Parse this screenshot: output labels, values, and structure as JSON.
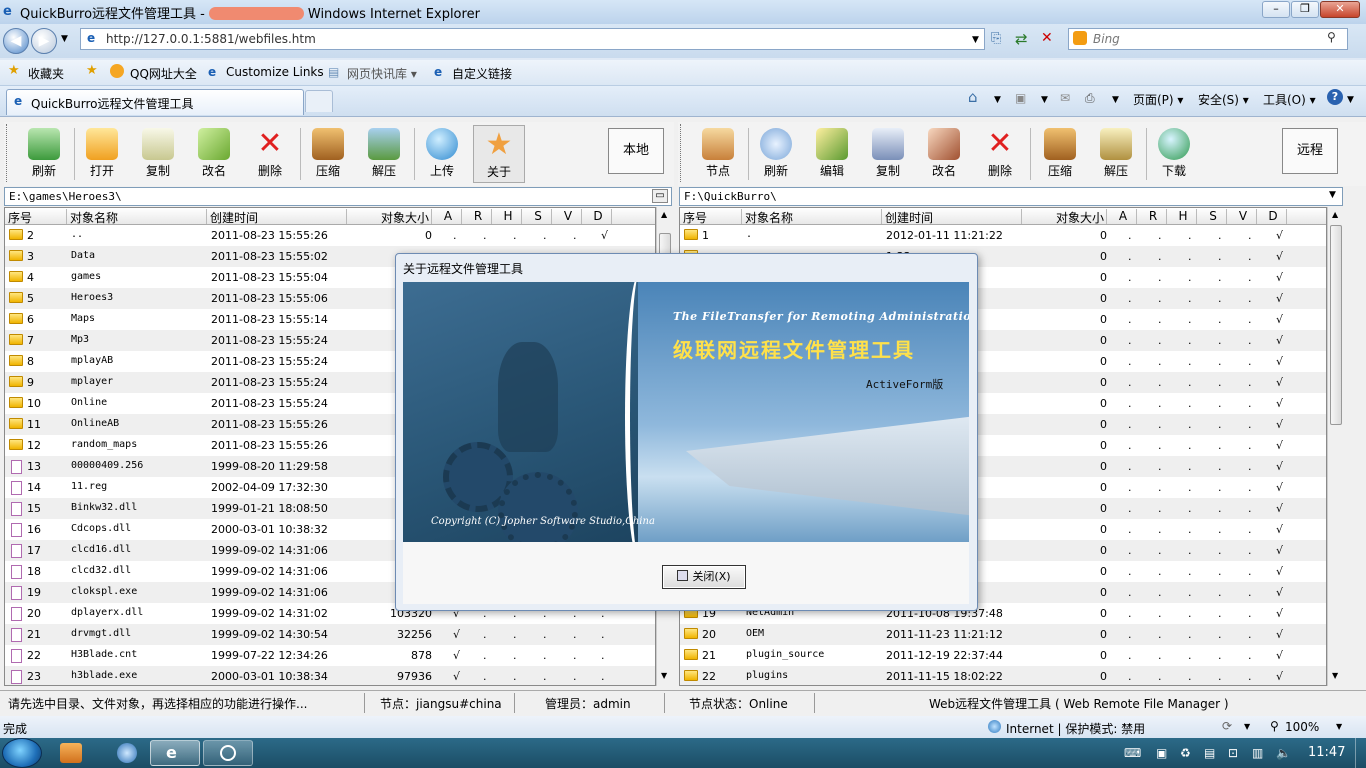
{
  "window": {
    "title_prefix": "QuickBurro远程文件管理工具 -",
    "title_suffix": "Windows Internet Explorer"
  },
  "address": {
    "url": "http://127.0.0.1:5881/webfiles.htm",
    "search_placeholder": "Bing"
  },
  "favorites": {
    "items": [
      "收藏夹",
      "QQ网址大全",
      "Customize Links",
      "网页快讯库 ▾",
      "自定义链接"
    ]
  },
  "tab": {
    "label": "QuickBurro远程文件管理工具"
  },
  "commands": {
    "page": "页面(P) ▾",
    "safety": "安全(S) ▾",
    "tools": "工具(O) ▾"
  },
  "left_toolbar": {
    "buttons": [
      "刷新",
      "打开",
      "复制",
      "改名",
      "删除",
      "压缩",
      "解压",
      "上传",
      "关于"
    ],
    "mode": "本地"
  },
  "right_toolbar": {
    "buttons": [
      "节点",
      "刷新",
      "编辑",
      "复制",
      "改名",
      "删除",
      "压缩",
      "解压",
      "下载"
    ],
    "mode": "远程"
  },
  "left_path": "E:\\games\\Heroes3\\",
  "right_path": "F:\\QuickBurro\\",
  "columns": {
    "seq": "序号",
    "name": "对象名称",
    "created": "创建时间",
    "size": "对象大小",
    "a": "A",
    "r": "R",
    "h": "H",
    "s": "S",
    "v": "V",
    "d": "D"
  },
  "left_rows": [
    {
      "n": "2",
      "name": "..",
      "t": "2011-08-23 15:55:26",
      "sz": "0",
      "a": ".",
      "r": ".",
      "h": ".",
      "s": ".",
      "v": ".",
      "d": "√",
      "dir": true
    },
    {
      "n": "3",
      "name": "Data",
      "t": "2011-08-23 15:55:02",
      "sz": "",
      "a": "",
      "r": "",
      "h": "",
      "s": "",
      "v": "",
      "d": "",
      "dir": true
    },
    {
      "n": "4",
      "name": "games",
      "t": "2011-08-23 15:55:04",
      "sz": "",
      "a": "",
      "r": "",
      "h": "",
      "s": "",
      "v": "",
      "d": "",
      "dir": true
    },
    {
      "n": "5",
      "name": "Heroes3",
      "t": "2011-08-23 15:55:06",
      "sz": "",
      "a": "",
      "r": "",
      "h": "",
      "s": "",
      "v": "",
      "d": "",
      "dir": true
    },
    {
      "n": "6",
      "name": "Maps",
      "t": "2011-08-23 15:55:14",
      "sz": "",
      "a": "",
      "r": "",
      "h": "",
      "s": "",
      "v": "",
      "d": "",
      "dir": true
    },
    {
      "n": "7",
      "name": "Mp3",
      "t": "2011-08-23 15:55:24",
      "sz": "",
      "a": "",
      "r": "",
      "h": "",
      "s": "",
      "v": "",
      "d": "",
      "dir": true
    },
    {
      "n": "8",
      "name": "mplayAB",
      "t": "2011-08-23 15:55:24",
      "sz": "",
      "a": "",
      "r": "",
      "h": "",
      "s": "",
      "v": "",
      "d": "",
      "dir": true
    },
    {
      "n": "9",
      "name": "mplayer",
      "t": "2011-08-23 15:55:24",
      "sz": "",
      "a": "",
      "r": "",
      "h": "",
      "s": "",
      "v": "",
      "d": "",
      "dir": true
    },
    {
      "n": "10",
      "name": "Online",
      "t": "2011-08-23 15:55:24",
      "sz": "",
      "a": "",
      "r": "",
      "h": "",
      "s": "",
      "v": "",
      "d": "",
      "dir": true
    },
    {
      "n": "11",
      "name": "OnlineAB",
      "t": "2011-08-23 15:55:26",
      "sz": "",
      "a": "",
      "r": "",
      "h": "",
      "s": "",
      "v": "",
      "d": "",
      "dir": true
    },
    {
      "n": "12",
      "name": "random_maps",
      "t": "2011-08-23 15:55:26",
      "sz": "",
      "a": "",
      "r": "",
      "h": "",
      "s": "",
      "v": "",
      "d": "",
      "dir": true
    },
    {
      "n": "13",
      "name": "00000409.256",
      "t": "1999-08-20 11:29:58",
      "sz": "",
      "a": "",
      "r": "",
      "h": "",
      "s": "",
      "v": "",
      "d": "",
      "dir": false
    },
    {
      "n": "14",
      "name": "11.reg",
      "t": "2002-04-09 17:32:30",
      "sz": "",
      "a": "",
      "r": "",
      "h": "",
      "s": "",
      "v": "",
      "d": "",
      "dir": false
    },
    {
      "n": "15",
      "name": "Binkw32.dll",
      "t": "1999-01-21 18:08:50",
      "sz": "",
      "a": "",
      "r": "",
      "h": "",
      "s": "",
      "v": "",
      "d": "",
      "dir": false
    },
    {
      "n": "16",
      "name": "Cdcops.dll",
      "t": "2000-03-01 10:38:32",
      "sz": "",
      "a": "",
      "r": "",
      "h": "",
      "s": "",
      "v": "",
      "d": "",
      "dir": false
    },
    {
      "n": "17",
      "name": "clcd16.dll",
      "t": "1999-09-02 14:31:06",
      "sz": "",
      "a": "",
      "r": "",
      "h": "",
      "s": "",
      "v": "",
      "d": "",
      "dir": false
    },
    {
      "n": "18",
      "name": "clcd32.dll",
      "t": "1999-09-02 14:31:06",
      "sz": "",
      "a": "",
      "r": "",
      "h": "",
      "s": "",
      "v": "",
      "d": "",
      "dir": false
    },
    {
      "n": "19",
      "name": "clokspl.exe",
      "t": "1999-09-02 14:31:06",
      "sz": "",
      "a": "",
      "r": "",
      "h": "",
      "s": "",
      "v": "",
      "d": "",
      "dir": false
    },
    {
      "n": "20",
      "name": "dplayerx.dll",
      "t": "1999-09-02 14:31:02",
      "sz": "103320",
      "a": "√",
      "r": ".",
      "h": ".",
      "s": ".",
      "v": ".",
      "d": ".",
      "dir": false
    },
    {
      "n": "21",
      "name": "drvmgt.dll",
      "t": "1999-09-02 14:30:54",
      "sz": "32256",
      "a": "√",
      "r": ".",
      "h": ".",
      "s": ".",
      "v": ".",
      "d": ".",
      "dir": false
    },
    {
      "n": "22",
      "name": "H3Blade.cnt",
      "t": "1999-07-22 12:34:26",
      "sz": "878",
      "a": "√",
      "r": ".",
      "h": ".",
      "s": ".",
      "v": ".",
      "d": ".",
      "dir": false
    },
    {
      "n": "23",
      "name": "h3blade.exe",
      "t": "2000-03-01 10:38:34",
      "sz": "97936",
      "a": "√",
      "r": ".",
      "h": ".",
      "s": ".",
      "v": ".",
      "d": ".",
      "dir": false
    }
  ],
  "right_rows": [
    {
      "n": "1",
      "name": ".",
      "t": "2012-01-11 11:21:22",
      "sz": "0"
    },
    {
      "n": "",
      "name": "",
      "t": "1:22",
      "sz": "0"
    },
    {
      "n": "",
      "name": "",
      "t": "3:22",
      "sz": "0"
    },
    {
      "n": "",
      "name": "",
      "t": "5:58",
      "sz": "0"
    },
    {
      "n": "",
      "name": "",
      "t": "3:08",
      "sz": "0"
    },
    {
      "n": "",
      "name": "",
      "t": "7:06",
      "sz": "0"
    },
    {
      "n": "",
      "name": "",
      "t": "8:58",
      "sz": "0"
    },
    {
      "n": "",
      "name": "",
      "t": "7:14",
      "sz": "0"
    },
    {
      "n": "",
      "name": "",
      "t": "1:16",
      "sz": "0"
    },
    {
      "n": "",
      "name": "",
      "t": "7:06",
      "sz": "0"
    },
    {
      "n": "",
      "name": "",
      "t": "6:48",
      "sz": "0"
    },
    {
      "n": "",
      "name": "",
      "t": "7:12",
      "sz": "0"
    },
    {
      "n": "",
      "name": "",
      "t": "4:38",
      "sz": "0"
    },
    {
      "n": "",
      "name": "",
      "t": "1:12",
      "sz": "0"
    },
    {
      "n": "",
      "name": "",
      "t": "3:32",
      "sz": "0"
    },
    {
      "n": "",
      "name": "",
      "t": "3:42",
      "sz": "0"
    },
    {
      "n": "",
      "name": "",
      "t": "6:02",
      "sz": "0"
    },
    {
      "n": "",
      "name": "",
      "t": "7:36",
      "sz": "0"
    },
    {
      "n": "19",
      "name": "NetAdmin",
      "t": "2011-10-08 19:37:48",
      "sz": "0"
    },
    {
      "n": "20",
      "name": "OEM",
      "t": "2011-11-23 11:21:12",
      "sz": "0"
    },
    {
      "n": "21",
      "name": "plugin_source",
      "t": "2011-12-19 22:37:44",
      "sz": "0"
    },
    {
      "n": "22",
      "name": "plugins",
      "t": "2011-11-15 18:02:22",
      "sz": "0"
    }
  ],
  "status": {
    "hint": "请先选中目录、文件对象，再选择相应的功能进行操作...",
    "node": "节点：jiangsu#china",
    "admin": "管理员：admin",
    "node_state": "节点状态：Online",
    "product": "Web远程文件管理工具 ( Web Remote File Manager )"
  },
  "ie_status": {
    "done": "完成",
    "zone": "Internet | 保护模式: 禁用",
    "zoom": "100%"
  },
  "taskbar": {
    "clock": "11:47"
  },
  "dialog": {
    "title": "关于远程文件管理工具",
    "line1": "The FileTransfer for Remoting Administration",
    "line2": "级联网远程文件管理工具",
    "line3": "ActiveForm版",
    "copyright": "Copyright (C) Jopher Software Studio,China",
    "close": "关闭(X)"
  },
  "colors": {
    "folder": "#f0b400",
    "accent": "#4d86c9"
  }
}
